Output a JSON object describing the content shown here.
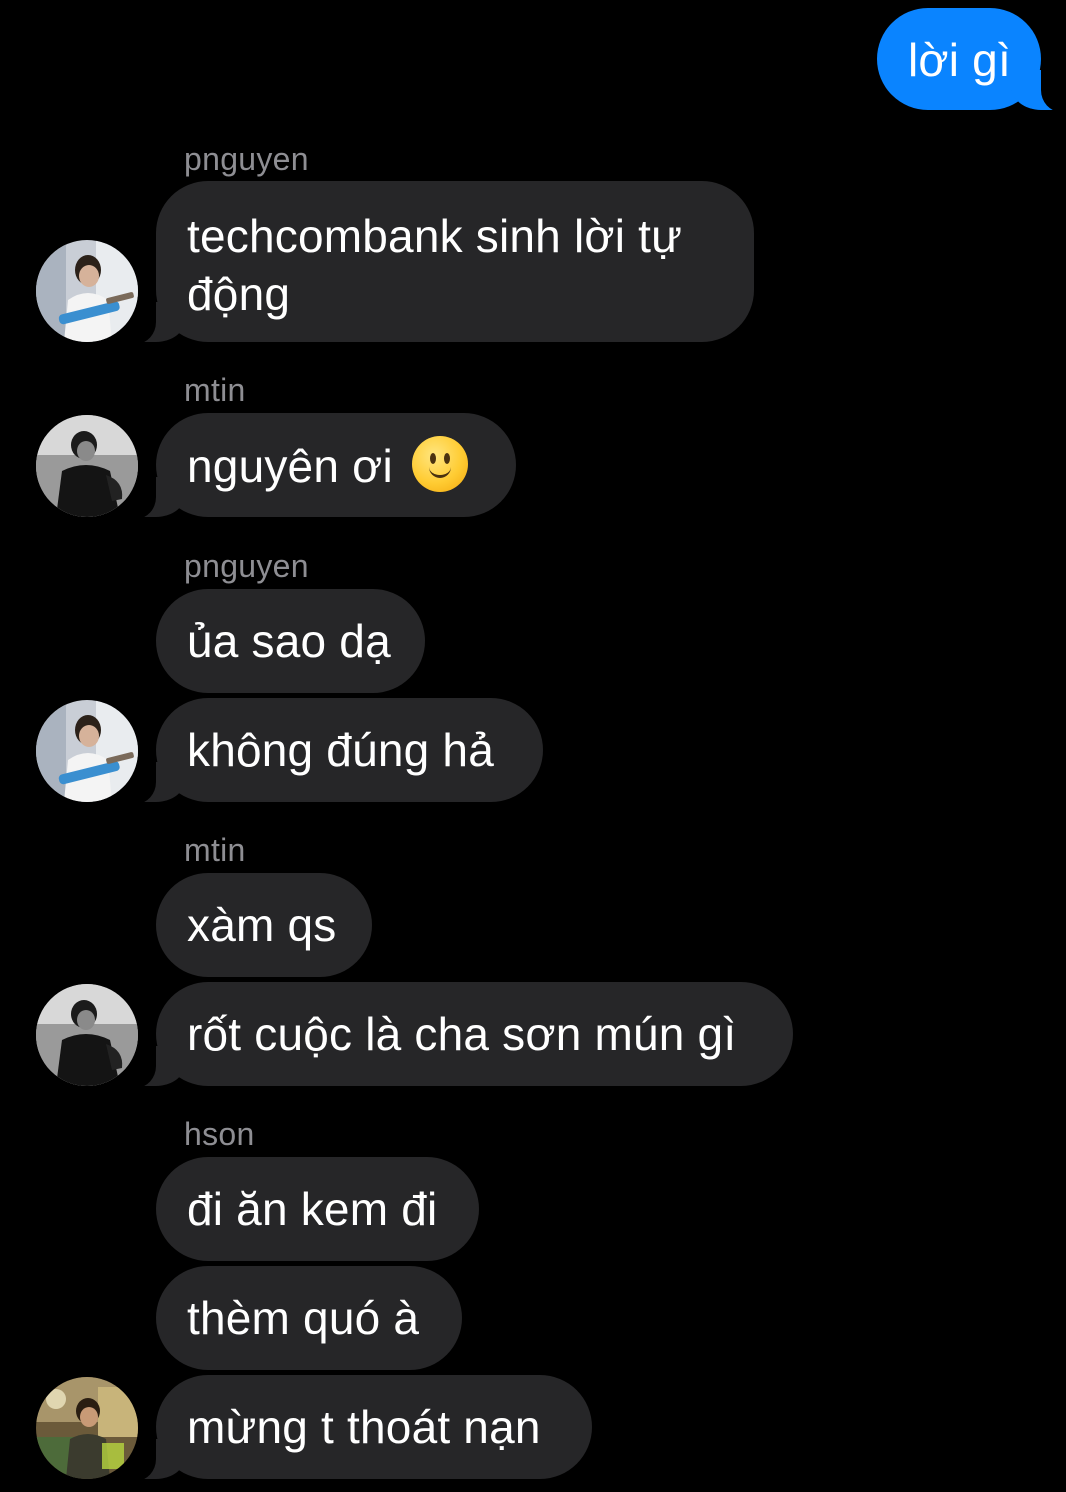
{
  "thread": {
    "outgoing": {
      "text": "lời gì"
    },
    "groups": [
      {
        "sender": "pnguyen",
        "messages": [
          "techcombank sinh lời tự động"
        ]
      },
      {
        "sender": "mtin",
        "messages": [
          "nguyên ơi"
        ]
      },
      {
        "sender": "pnguyen",
        "messages": [
          "ủa sao dạ",
          "không đúng hả"
        ]
      },
      {
        "sender": "mtin",
        "messages": [
          "xàm qs",
          "rốt cuộc là cha sơn mún gì"
        ]
      },
      {
        "sender": "hson",
        "messages": [
          "đi ăn kem đi",
          "thèm quó à",
          "mừng t thoát nạn"
        ]
      }
    ],
    "emoji": {
      "icon": "slightly-smiling-face"
    }
  },
  "colors": {
    "background": "#000000",
    "incoming_bubble": "#262628",
    "outgoing_bubble": "#0a84ff",
    "sender_name": "#8e8e93",
    "text": "#ffffff"
  },
  "avatars": {
    "pnguyen": "avatar-pnguyen",
    "mtin": "avatar-mtin",
    "hson": "avatar-hson"
  }
}
